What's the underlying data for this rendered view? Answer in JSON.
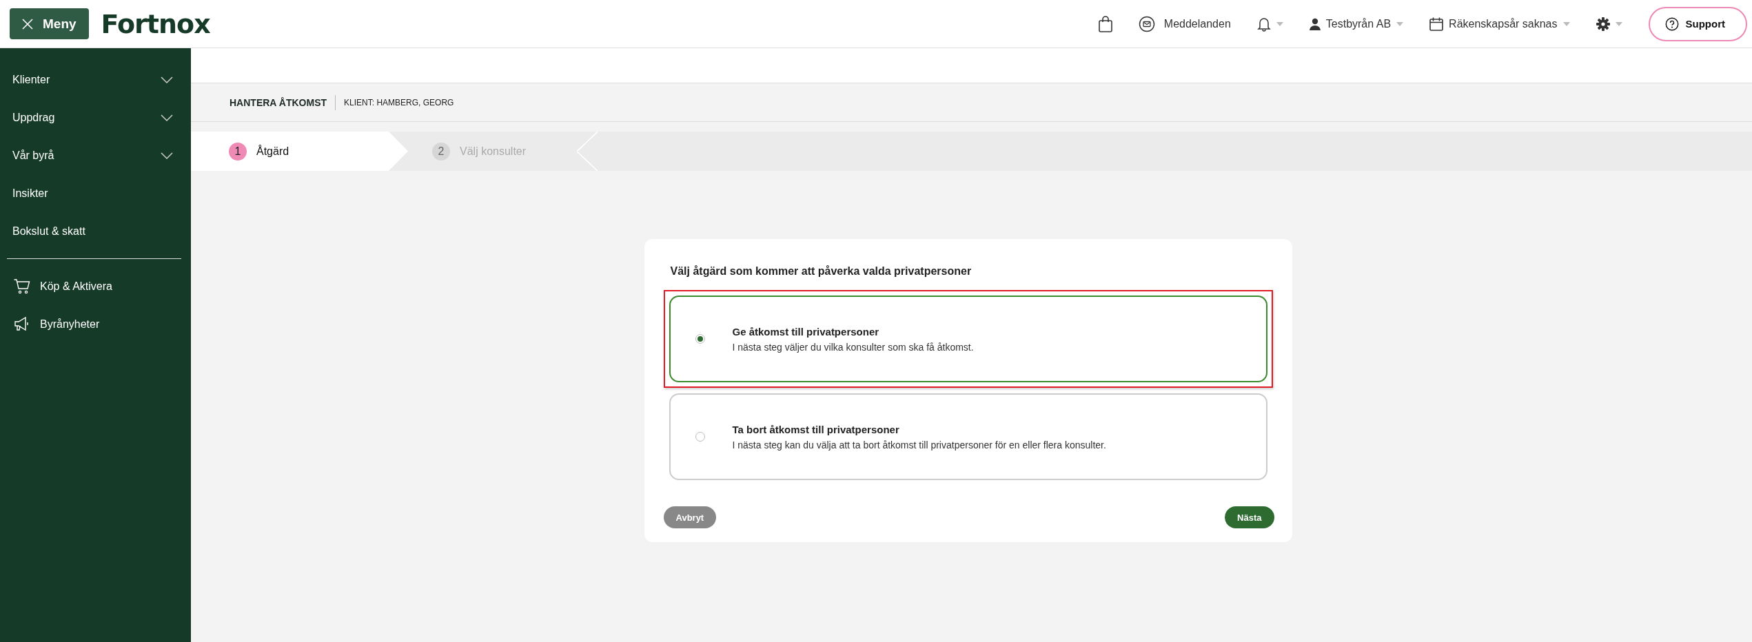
{
  "topbar": {
    "menu_button": "Meny",
    "logo": "Fortnox",
    "messages": "Meddelanden",
    "company": "Testbyrån AB",
    "fiscal_year": "Räkenskapsår saknas",
    "support": "Support"
  },
  "sidebar": {
    "items": [
      {
        "label": "Klienter",
        "kind": "group",
        "expanded": false
      },
      {
        "label": "Uppdrag",
        "kind": "group",
        "expanded": false
      },
      {
        "label": "Vår byrå",
        "kind": "group",
        "expanded": false
      },
      {
        "label": "Insikter",
        "kind": "link"
      },
      {
        "label": "Bokslut & skatt",
        "kind": "link"
      }
    ],
    "extras": [
      {
        "label": "Köp & Aktivera",
        "kind": "cart"
      },
      {
        "label": "Byrånyheter",
        "kind": "megaphone"
      }
    ]
  },
  "page_header": {
    "title": "HANTERA ÅTKOMST",
    "client": "KLIENT: HAMBERG, GEORG"
  },
  "steps": [
    {
      "number": "1",
      "label": "Åtgärd",
      "selected": true
    },
    {
      "number": "2",
      "label": "Välj konsulter",
      "selected": false
    }
  ],
  "card": {
    "question": "Välj åtgärd som kommer att påverka valda privatpersoner",
    "options": [
      {
        "title": "Ge åtkomst till privatpersoner",
        "description": "I nästa steg väljer du vilka konsulter som ska få åtkomst.",
        "selected": true,
        "highlighted": true
      },
      {
        "title": "Ta bort åtkomst till privatpersoner",
        "description": "I nästa steg kan du välja att ta bort åtkomst till privatpersoner för en eller flera konsulter.",
        "selected": false,
        "highlighted": false
      }
    ],
    "cancel_button": "Avbryt",
    "next_button": "Nästa"
  }
}
